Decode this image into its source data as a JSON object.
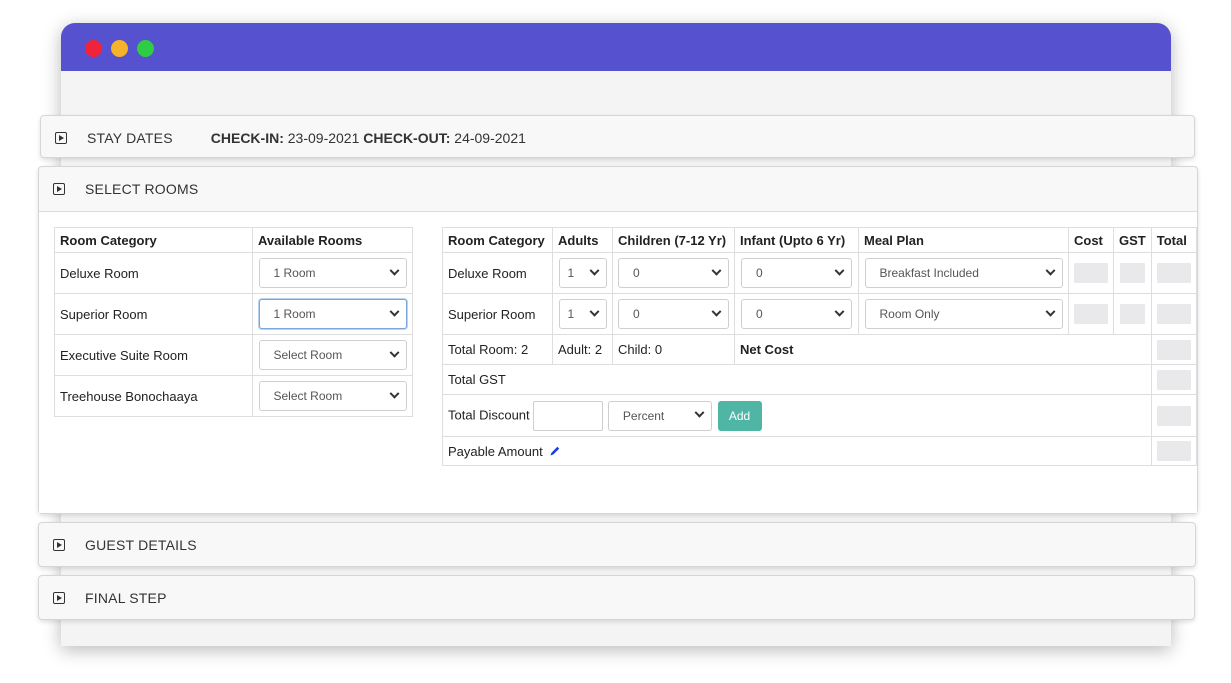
{
  "window": {
    "controls": [
      "close",
      "minimize",
      "maximize"
    ]
  },
  "stay": {
    "title": "STAY DATES",
    "checkin_label": "CHECK-IN:",
    "checkin_value": "23-09-2021",
    "checkout_label": "CHECK-OUT:",
    "checkout_value": "24-09-2021"
  },
  "select_rooms": {
    "title": "SELECT ROOMS",
    "left_table": {
      "headers": [
        "Room Category",
        "Available Rooms"
      ],
      "rows": [
        {
          "category": "Deluxe Room",
          "selection": "1 Room"
        },
        {
          "category": "Superior Room",
          "selection": "1 Room"
        },
        {
          "category": "Executive Suite Room",
          "selection": "Select Room"
        },
        {
          "category": "Treehouse Bonochaaya",
          "selection": "Select Room"
        }
      ]
    },
    "right_table": {
      "headers": [
        "Room Category",
        "Adults",
        "Children (7-12 Yr)",
        "Infant (Upto 6 Yr)",
        "Meal Plan",
        "Cost",
        "GST",
        "Total"
      ],
      "rows": [
        {
          "category": "Deluxe Room",
          "adults": "1",
          "children": "0",
          "infant": "0",
          "meal_plan": "Breakfast Included"
        },
        {
          "category": "Superior Room",
          "adults": "1",
          "children": "0",
          "infant": "0",
          "meal_plan": "Room Only"
        }
      ],
      "total_room": "Total Room: 2",
      "adult_total": "Adult: 2",
      "child_total": "Child: 0",
      "net_cost_label": "Net Cost",
      "total_gst_label": "Total GST",
      "total_discount_label": "Total Discount",
      "discount_type": "Percent",
      "add_label": "Add",
      "payable_label": "Payable Amount"
    }
  },
  "guest": {
    "title": "GUEST DETAILS"
  },
  "final": {
    "title": "FINAL STEP"
  },
  "colors": {
    "titlebar": "#5551cf",
    "add_button": "#4fb6a6",
    "edit_icon": "#1a3be0"
  },
  "icons": {
    "section_toggle": "play-square-icon",
    "edit": "pencil-icon"
  }
}
